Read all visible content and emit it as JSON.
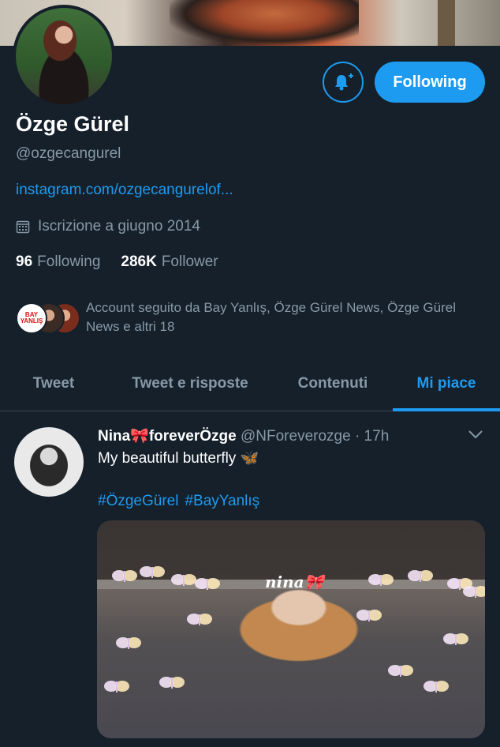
{
  "profile": {
    "name": "Özge Gürel",
    "handle": "@ozgecangurel",
    "link": "instagram.com/ozgecangurelof...",
    "joined": "Iscrizione a giugno 2014",
    "following_count": "96",
    "following_label": "Following",
    "followers_count": "286K",
    "followers_label": "Follower",
    "follow_button_label": "Following",
    "followed_by_text": "Account seguito da Bay Yanlış, Özge Gürel News, Özge Gürel News e altri 18",
    "mini_avatar_label": "BAY YANLIŞ"
  },
  "tabs": [
    {
      "label": "Tweet",
      "active": false
    },
    {
      "label": "Tweet e risposte",
      "active": false
    },
    {
      "label": "Contenuti",
      "active": false
    },
    {
      "label": "Mi piace",
      "active": true
    }
  ],
  "tweet": {
    "display_name": "Nina🎀foreverÖzge",
    "meta": "@NForeverozge · 17h",
    "text": "My beautiful butterfly 🦋",
    "hashtags": [
      "#ÖzgeGürel",
      "#BayYanlış"
    ],
    "media_label": "nina🎀"
  },
  "colors": {
    "background": "#15202b",
    "accent": "#1d9bf0",
    "secondary_text": "#8899a6",
    "divider": "#38444d"
  },
  "icons": [
    "bell-plus-icon",
    "calendar-icon",
    "chevron-down-icon"
  ]
}
